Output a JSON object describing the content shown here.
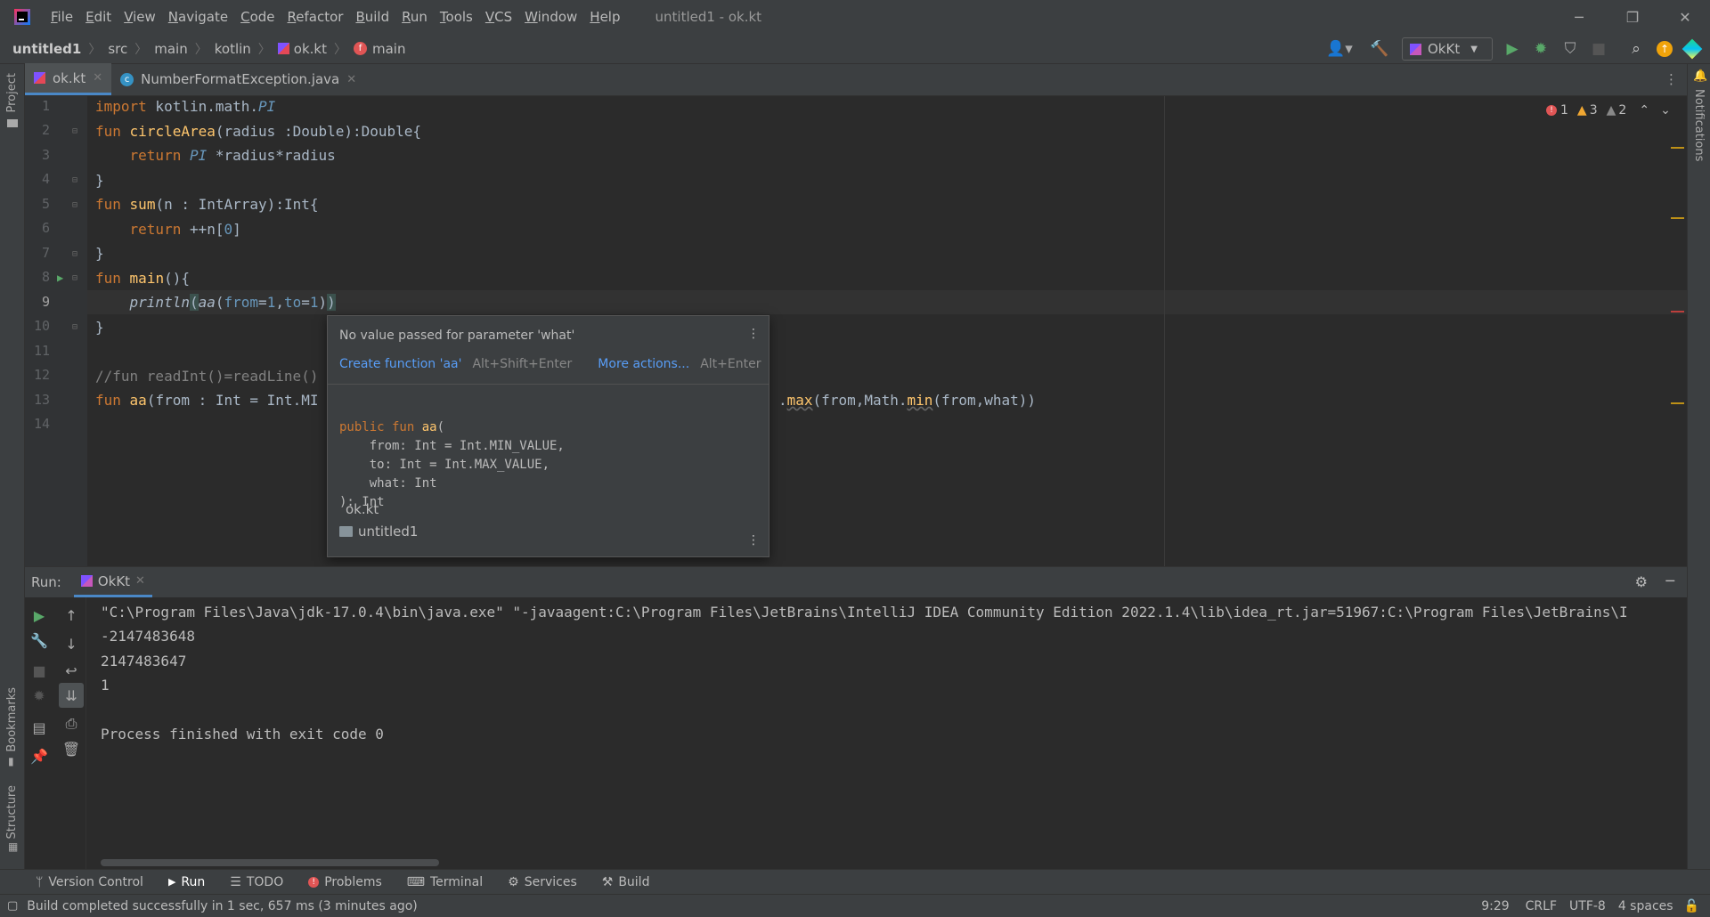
{
  "window": {
    "title": "untitled1 - ok.kt",
    "menu": [
      "File",
      "Edit",
      "View",
      "Navigate",
      "Code",
      "Refactor",
      "Build",
      "Run",
      "Tools",
      "VCS",
      "Window",
      "Help"
    ]
  },
  "breadcrumb": {
    "project": "untitled1",
    "items": [
      "src",
      "main",
      "kotlin",
      "ok.kt",
      "main"
    ]
  },
  "toolbar": {
    "run_config": "OkKt"
  },
  "tabs": [
    {
      "label": "ok.kt",
      "active": true
    },
    {
      "label": "NumberFormatException.java",
      "active": false
    }
  ],
  "inspections": {
    "errors": "1",
    "warnings": "3",
    "weak_warnings": "2"
  },
  "editor": {
    "line_numbers": [
      "1",
      "2",
      "3",
      "4",
      "5",
      "6",
      "7",
      "8",
      "9",
      "10",
      "11",
      "12",
      "13",
      "14"
    ],
    "current_line": "9"
  },
  "popup": {
    "message": "No value passed for parameter 'what'",
    "action1": "Create function 'aa'",
    "action1_shortcut": "Alt+Shift+Enter",
    "action2": "More actions...",
    "action2_shortcut": "Alt+Enter",
    "signature": [
      "public fun aa(",
      "    from: Int = Int.MIN_VALUE,",
      "    to: Int = Int.MAX_VALUE,",
      "    what: Int",
      "): Int"
    ],
    "file": "ok.kt",
    "module": "untitled1"
  },
  "run": {
    "label": "Run:",
    "tab": "OkKt",
    "output": [
      "\"C:\\Program Files\\Java\\jdk-17.0.4\\bin\\java.exe\" \"-javaagent:C:\\Program Files\\JetBrains\\IntelliJ IDEA Community Edition 2022.1.4\\lib\\idea_rt.jar=51967:C:\\Program Files\\JetBrains\\I",
      "-2147483648",
      "2147483647",
      "1",
      "",
      "Process finished with exit code 0"
    ]
  },
  "side": {
    "project": "Project",
    "bookmarks": "Bookmarks",
    "structure": "Structure",
    "notifications": "Notifications"
  },
  "bottom_tabs": [
    "Version Control",
    "Run",
    "TODO",
    "Problems",
    "Terminal",
    "Services",
    "Build"
  ],
  "status": {
    "message": "Build completed successfully in 1 sec, 657 ms (3 minutes ago)",
    "position": "9:29",
    "line_sep": "CRLF",
    "encoding": "UTF-8",
    "indent": "4 spaces"
  }
}
